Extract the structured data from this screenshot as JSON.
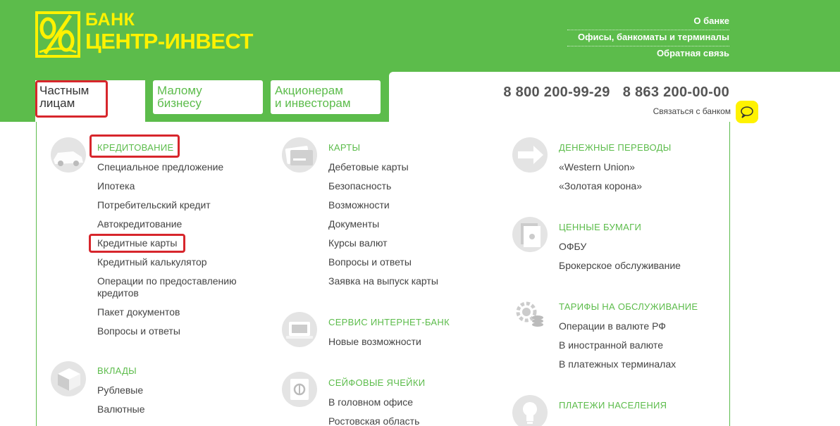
{
  "brand": {
    "line1": "БАНК",
    "line2": "ЦЕНТР-ИНВЕСТ",
    "color": "#fff200"
  },
  "top_links": [
    "О банке",
    "Офисы, банкоматы и терминалы",
    "Обратная связь"
  ],
  "tabs": [
    {
      "label_line1": "Частным",
      "label_line2": "лицам"
    },
    {
      "label_line1": "Малому",
      "label_line2": "бизнесу"
    },
    {
      "label_line1": "Акционерам",
      "label_line2": "и инвесторам"
    }
  ],
  "phones": [
    "8 800 200-99-29",
    "8 863 200-00-00"
  ],
  "contact_label": "Связаться с банком",
  "icons": {
    "chat": "speech-bubble-icon",
    "credit": "car-icon",
    "cards": "bank-card-icon",
    "transfers": "arrow-transfer-icon",
    "securities": "document-icon",
    "tariffs": "gear-coins-icon",
    "internet_bank": "laptop-icon",
    "safe_boxes": "safe-icon",
    "deposits": "coin-stack-icon",
    "payments": "lightbulb-icon"
  },
  "colors": {
    "brand_green": "#5cbc4b",
    "highlight_red": "#d7262c",
    "text": "#444444"
  },
  "menu": {
    "credit": {
      "title": "КРЕДИТОВАНИЕ",
      "items": [
        "Специальное предложение",
        "Ипотека",
        "Потребительский кредит",
        "Автокредитование",
        "Кредитные карты",
        "Кредитный калькулятор",
        "Операции по предоставлению кредитов",
        "Пакет документов",
        "Вопросы и ответы"
      ]
    },
    "deposits": {
      "title": "ВКЛАДЫ",
      "items": [
        "Рублевые",
        "Валютные"
      ]
    },
    "cards": {
      "title": "КАРТЫ",
      "items": [
        "Дебетовые карты",
        "Безопасность",
        "Возможности",
        "Документы",
        "Курсы валют",
        "Вопросы и ответы",
        "Заявка на выпуск карты"
      ]
    },
    "internet_bank": {
      "title": "СЕРВИС ИНТЕРНЕТ-БАНК",
      "items": [
        "Новые возможности"
      ]
    },
    "safe_boxes": {
      "title": "СЕЙФОВЫЕ ЯЧЕЙКИ",
      "items": [
        "В головном офисе",
        "Ростовская область"
      ]
    },
    "transfers": {
      "title": "ДЕНЕЖНЫЕ ПЕРЕВОДЫ",
      "items": [
        "«Western Union»",
        "«Золотая корона»"
      ]
    },
    "securities": {
      "title": "ЦЕННЫЕ БУМАГИ",
      "items": [
        "ОФБУ",
        "Брокерское обслуживание"
      ]
    },
    "tariffs": {
      "title": "ТАРИФЫ НА ОБСЛУЖИВАНИЕ",
      "items": [
        "Операции в валюте РФ",
        "В иностранной валюте",
        "В платежных терминалах"
      ]
    },
    "payments": {
      "title": "ПЛАТЕЖИ НАСЕЛЕНИЯ",
      "items": []
    }
  }
}
